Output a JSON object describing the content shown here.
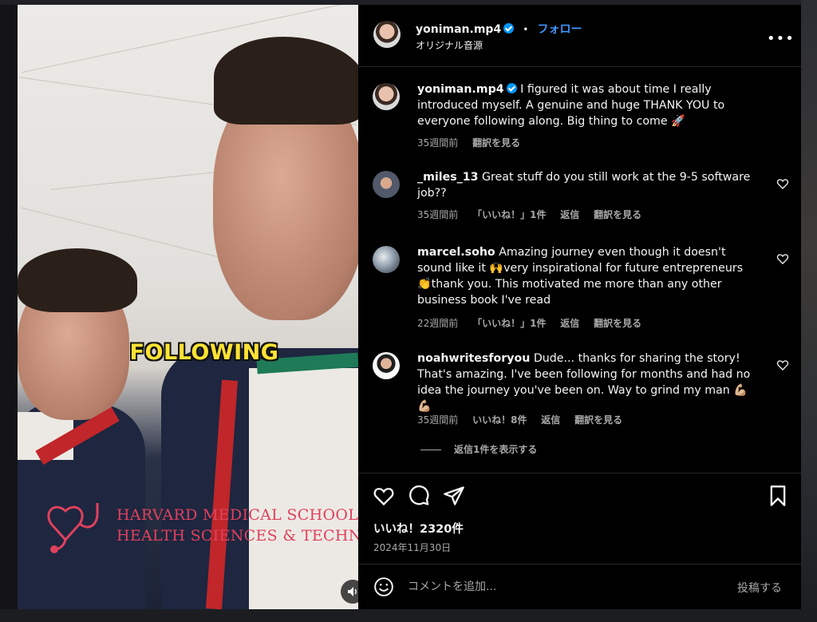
{
  "post": {
    "username": "yoniman.mp4",
    "follow_label": "フォロー",
    "audio_label": "オリジナル音源",
    "more_label": "•••",
    "video_overlay_text": "FOLLOWING",
    "video_logo_line1": "HARVARD MEDICAL SCHOOL",
    "video_logo_line2": "HEALTH SCIENCES & TECHNOLOGY"
  },
  "caption": {
    "username": "yoniman.mp4",
    "text": "I figured it was about time I really introduced myself. A genuine and huge THANK YOU to everyone following along. Big thing to come 🚀",
    "time": "35週間前",
    "translate": "翻訳を見る"
  },
  "comments": [
    {
      "username": "_miles_13",
      "text": "Great stuff do you still work at the 9-5 software job??",
      "time": "35週間前",
      "likes": "「いいね！」1件",
      "reply": "返信",
      "translate": "翻訳を見る"
    },
    {
      "username": "marcel.soho",
      "text": "Amazing journey even though it doesn't sound like it 🙌very inspirational for future entrepreneurs 👏thank you. This motivated me more than any other business book I've read",
      "time": "22週間前",
      "likes": "「いいね！」1件",
      "reply": "返信",
      "translate": "翻訳を見る"
    },
    {
      "username": "noahwritesforyou",
      "text": "Dude... thanks for sharing the story! That's amazing. I've been following for months and had no idea the journey you've been on. Way to grind my man 💪🏼💪🏼",
      "time": "35週間前",
      "likes": "いいね！8件",
      "reply": "返信",
      "translate": "翻訳を見る"
    }
  ],
  "view_replies": "返信1件を表示する",
  "likes_count": "いいね！2320件",
  "post_date": "2024年11月30日",
  "comment_box": {
    "placeholder": "コメントを追加...",
    "post_label": "投稿する"
  },
  "colors": {
    "accent": "#0095f6",
    "follow": "#4096ff",
    "secondary_text": "#a8a8a8"
  }
}
